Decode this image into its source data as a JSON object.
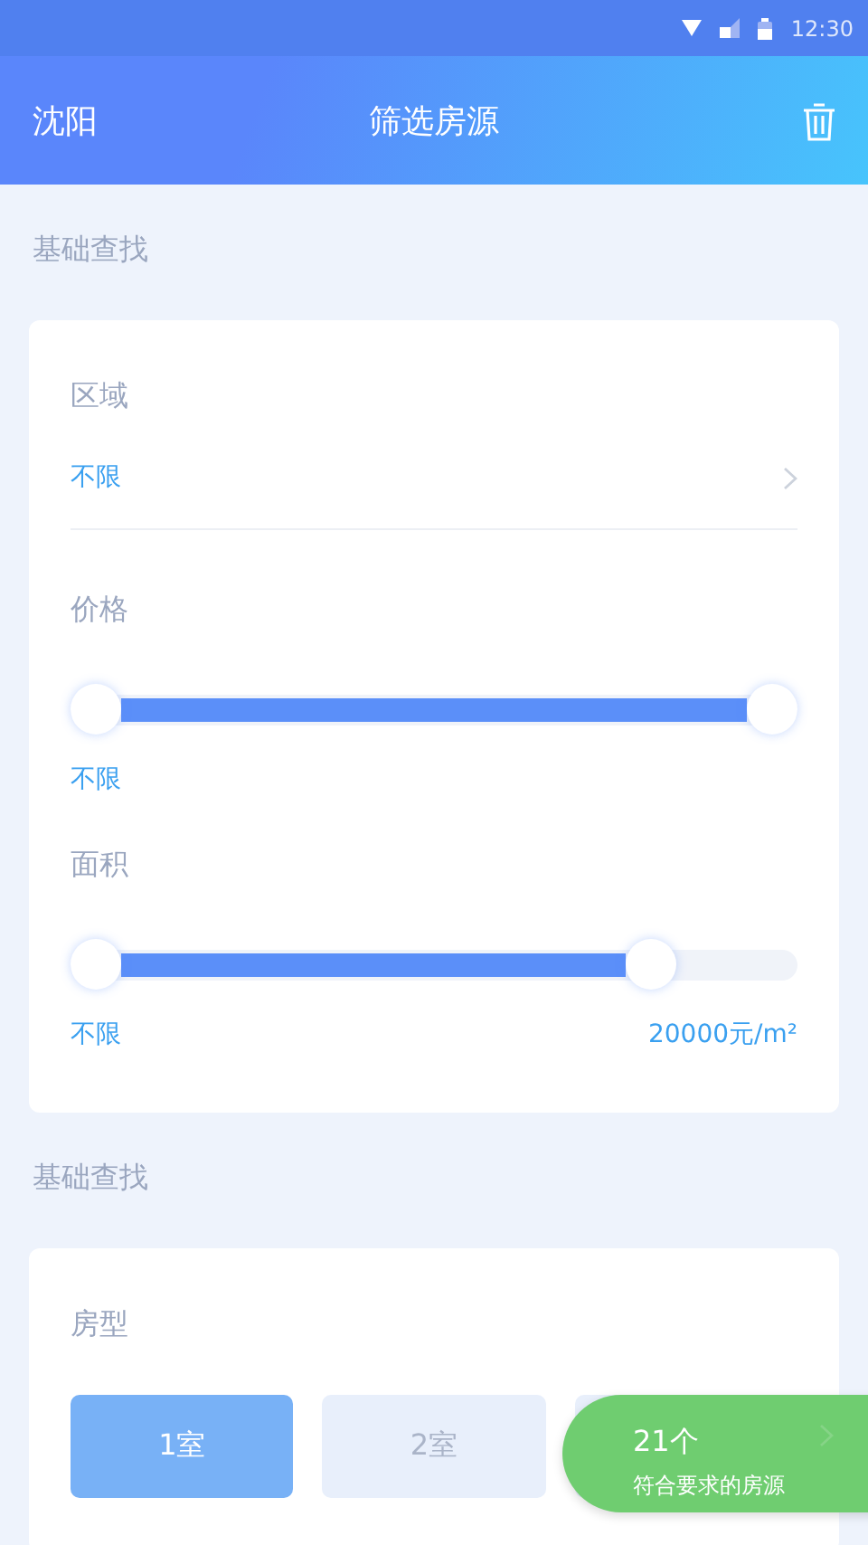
{
  "status_bar": {
    "time": "12:30"
  },
  "header": {
    "city": "沈阳",
    "title": "筛选房源"
  },
  "sections": [
    {
      "title": "基础查找",
      "filters": [
        {
          "kind": "select",
          "label": "区域",
          "value": "不限"
        },
        {
          "kind": "range",
          "label": "价格",
          "thumbs": [
            {
              "level": 0
            },
            {
              "level": 1
            }
          ],
          "min_label": "不限"
        },
        {
          "kind": "range",
          "label": "面积",
          "thumbs": [
            {
              "level": 0
            },
            {
              "level": 0.82
            }
          ],
          "min_label": "不限",
          "max_label": "20000元/m²"
        }
      ]
    },
    {
      "title": "基础查找",
      "filters": [
        {
          "kind": "options",
          "label": "房型",
          "options": [
            {
              "label": "1室",
              "selected": true
            },
            {
              "label": "2室",
              "selected": false
            },
            {
              "selected": false
            }
          ]
        }
      ]
    }
  ],
  "result_button": {
    "count": "21个",
    "caption": "符合要求的房源"
  }
}
